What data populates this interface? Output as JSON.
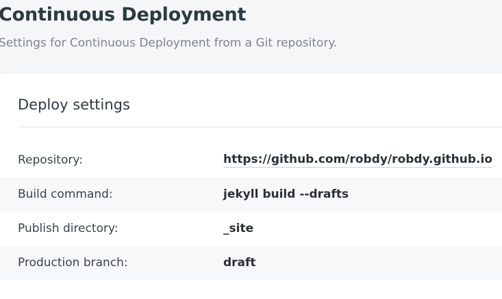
{
  "header": {
    "title": "Continuous Deployment",
    "subtitle": "Settings for Continuous Deployment from a Git repository."
  },
  "deploy_settings": {
    "title": "Deploy settings",
    "rows": [
      {
        "label": "Repository:",
        "value": "https://github.com/robdy/robdy.github.io"
      },
      {
        "label": "Build command:",
        "value": "jekyll build --drafts"
      },
      {
        "label": "Publish directory:",
        "value": "_site"
      },
      {
        "label": "Production branch:",
        "value": "draft"
      }
    ]
  }
}
